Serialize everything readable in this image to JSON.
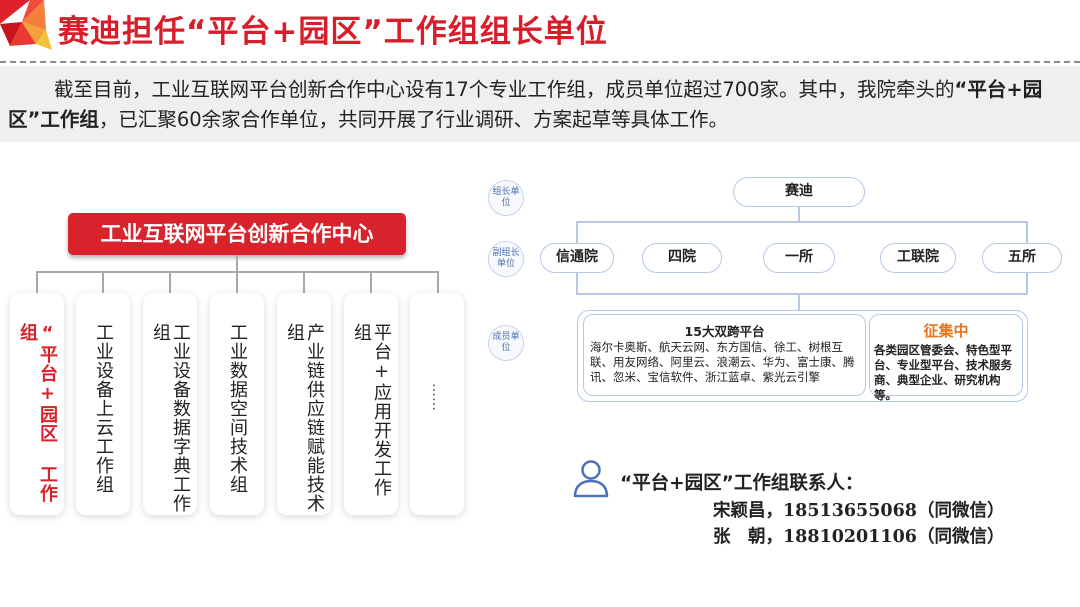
{
  "header": {
    "title": "赛迪担任“平台+园区”工作组组长单位",
    "accent_color": "#d81e2a"
  },
  "intro": {
    "part1": "截至目前，工业互联网平台创新合作中心设有17个专业工作组，成员单位超过700家。其中，我院牵头的",
    "highlight": "“平台+园区”工作组",
    "part2": "，已汇聚60余家合作单位，共同开展了行业调研、方案起草等具体工作。"
  },
  "center": {
    "name": "工业互联网平台创新合作中心"
  },
  "working_groups": [
    {
      "label": "“平台+园区 工作组",
      "highlight": true
    },
    {
      "label": "工业设备上云工作组",
      "highlight": false
    },
    {
      "label": "工业设备数据字典工作组",
      "highlight": false
    },
    {
      "label": "工业数据空间技术组",
      "highlight": false
    },
    {
      "label": "产业链供应链赋能技术组",
      "highlight": false
    },
    {
      "label": "平台+应用开发工作组",
      "highlight": false
    },
    {
      "label": "……",
      "highlight": false
    }
  ],
  "org_chart": {
    "tiers": {
      "leader": "组长单位",
      "deputy": "副组长单位",
      "member": "成员单位"
    },
    "leader": "赛迪",
    "deputies": [
      "信通院",
      "四院",
      "一所",
      "工联院",
      "五所"
    ],
    "platforms": {
      "title": "15大双跨平台",
      "list": "海尔卡奥斯、航天云网、东方国信、徐工、树根互联、用友网络、阿里云、浪潮云、华为、富士康、腾讯、忽米、宝信软件、浙江蓝卓、紫光云引擎"
    },
    "recruiting": {
      "title": "征集中",
      "text": "各类园区管委会、特色型平台、专业型平台、技术服务商、典型企业、研究机构等。",
      "color": "#e8731c"
    }
  },
  "contacts": {
    "title": "“平台+园区”工作组联系人：",
    "people": [
      "宋颖昌，18513655068（同微信）",
      "张　朝，18810201106（同微信）"
    ]
  }
}
